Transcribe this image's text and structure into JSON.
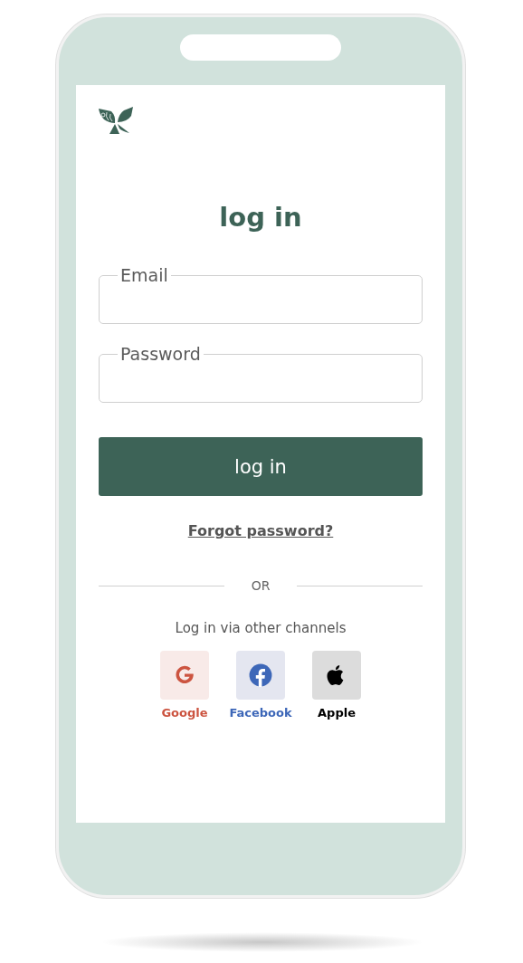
{
  "title": "log in",
  "fields": [
    {
      "label": "Email"
    },
    {
      "label": "Password"
    }
  ],
  "login_button": "log in",
  "forgot_link": "Forgot password?",
  "divider_text": "OR",
  "channels_caption": "Log in via other channels",
  "channels": [
    {
      "kind": "google",
      "label": "Google",
      "color": "#cc5440"
    },
    {
      "kind": "facebook",
      "label": "Facebook",
      "color": "#3d67b8"
    },
    {
      "kind": "apple",
      "label": "Apple",
      "color": "#000000"
    }
  ]
}
